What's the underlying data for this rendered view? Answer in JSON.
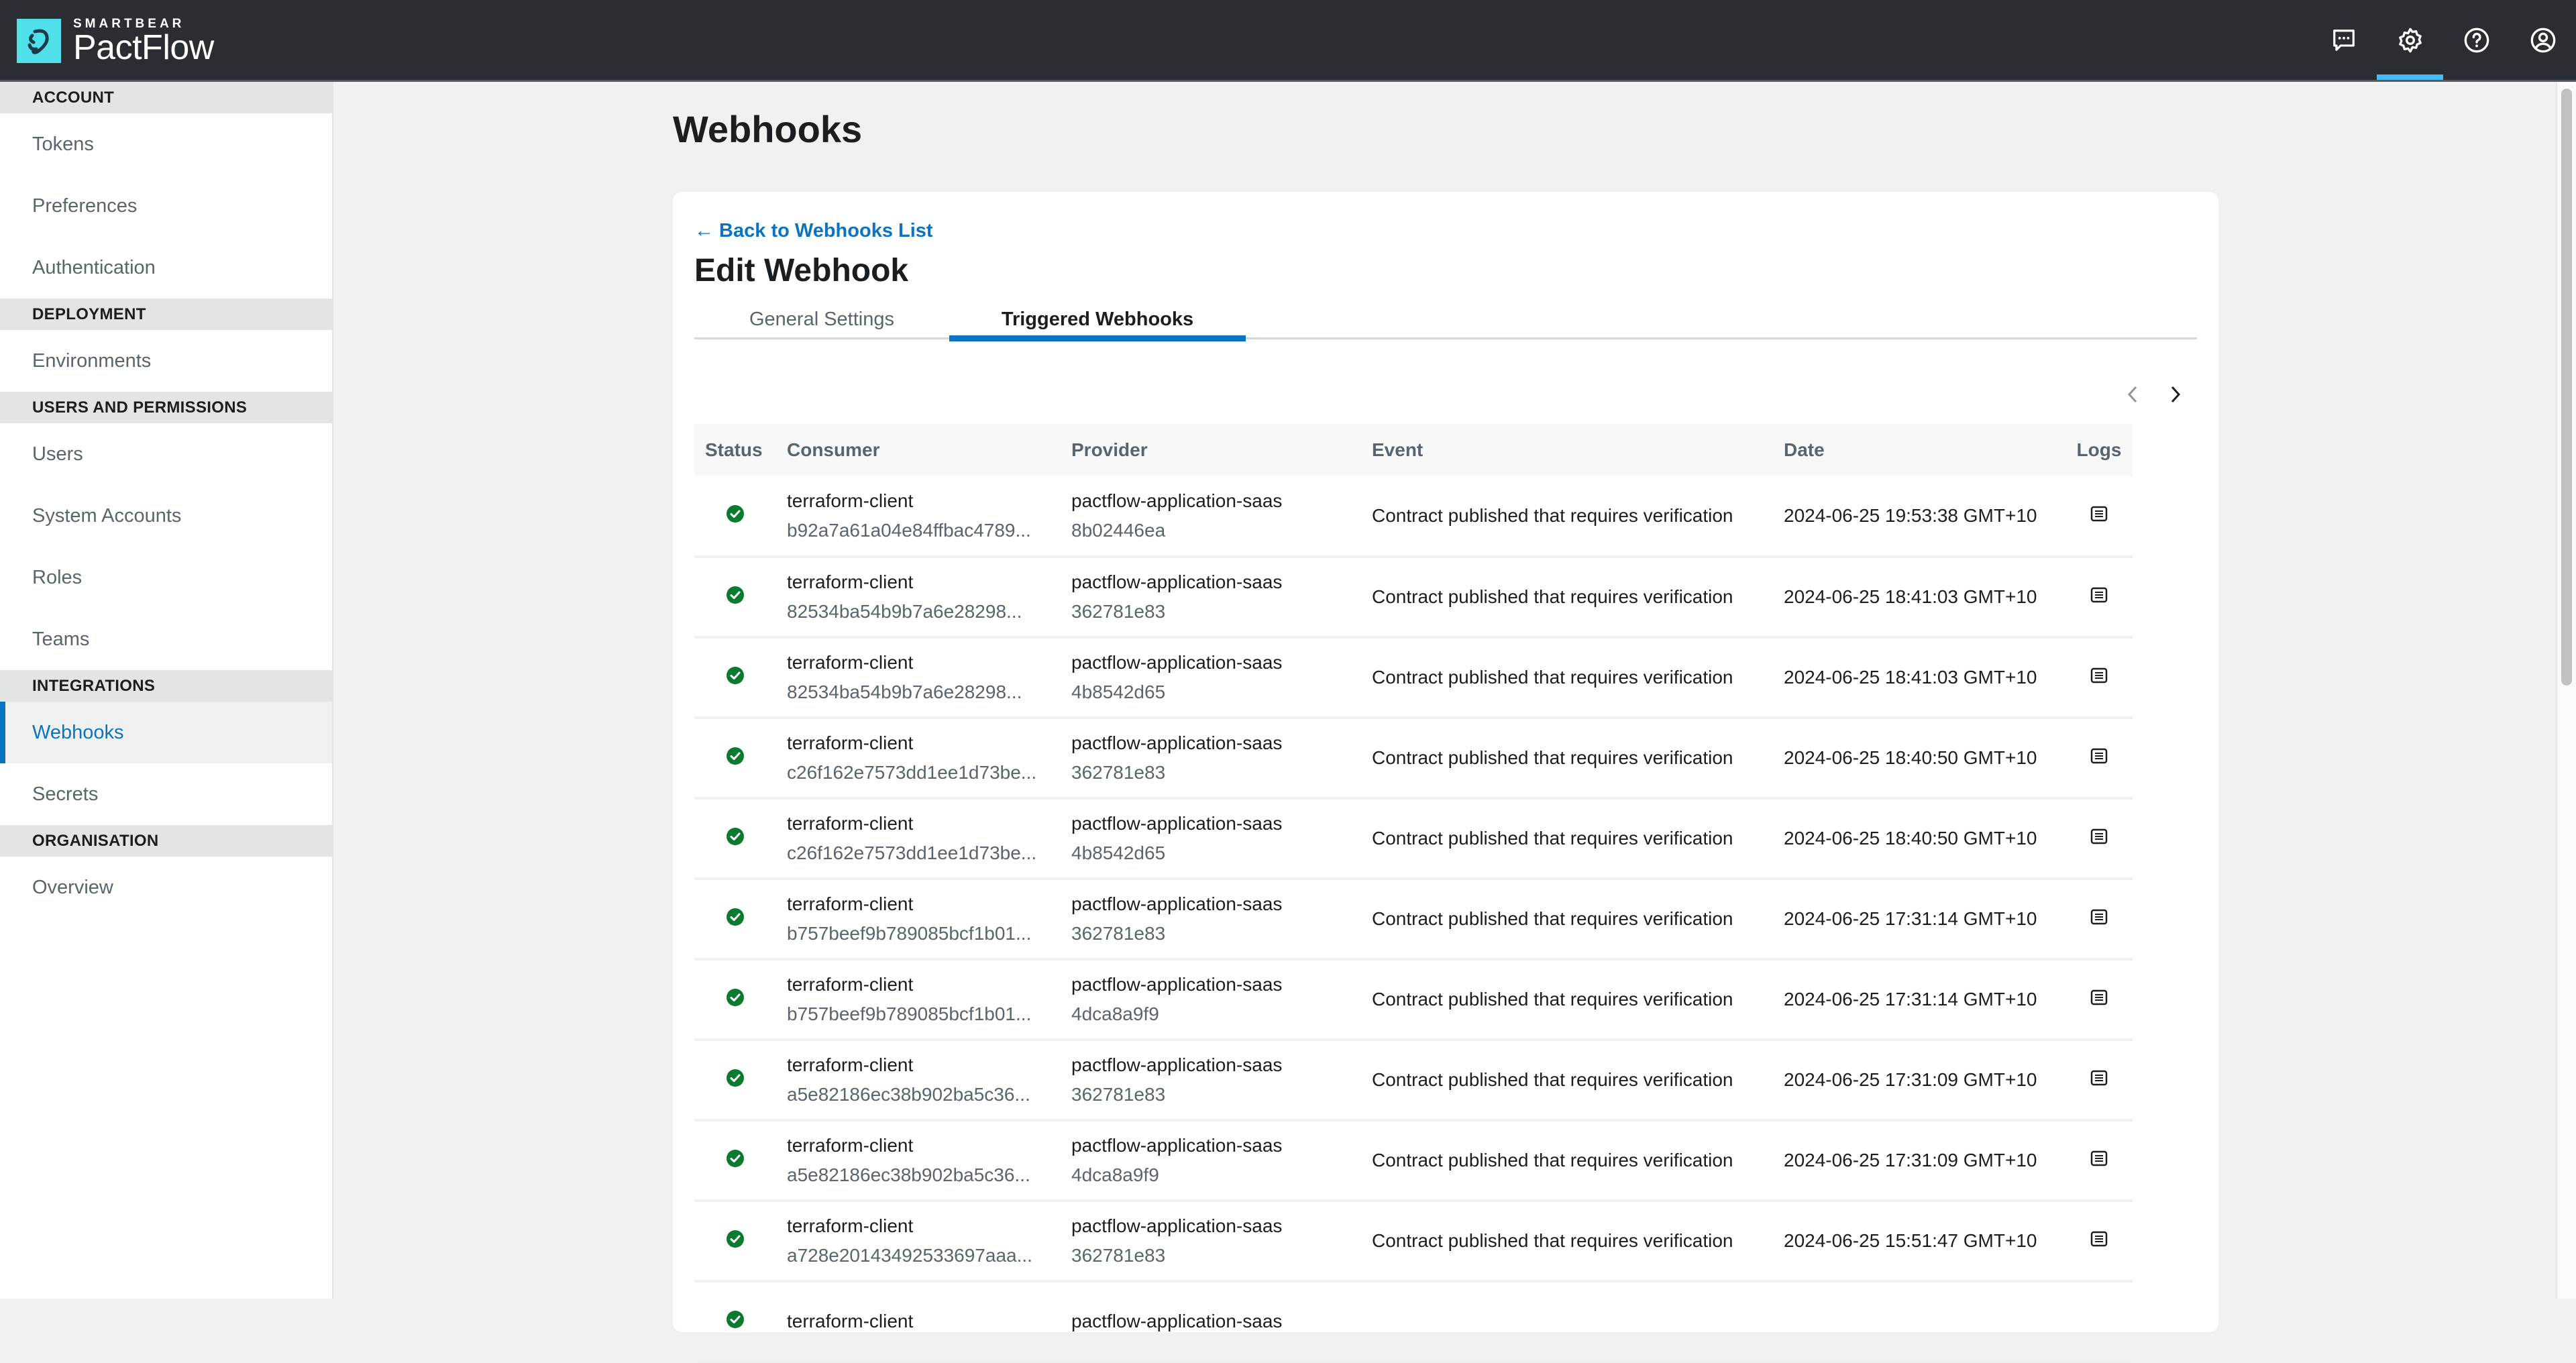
{
  "header": {
    "brand_sub": "SMARTBEAR",
    "brand_name": "PactFlow",
    "icons": [
      {
        "name": "feedback-icon",
        "label": "Feedback"
      },
      {
        "name": "settings-icon",
        "label": "Settings",
        "active": true
      },
      {
        "name": "help-icon",
        "label": "Help"
      },
      {
        "name": "account-icon",
        "label": "Account"
      }
    ],
    "accent": "#42bbf7"
  },
  "sidebar": {
    "sections": [
      {
        "title": "ACCOUNT",
        "items": [
          "Tokens",
          "Preferences",
          "Authentication"
        ]
      },
      {
        "title": "DEPLOYMENT",
        "items": [
          "Environments"
        ]
      },
      {
        "title": "USERS AND PERMISSIONS",
        "items": [
          "Users",
          "System Accounts",
          "Roles",
          "Teams"
        ]
      },
      {
        "title": "INTEGRATIONS",
        "items": [
          "Webhooks",
          "Secrets"
        ]
      },
      {
        "title": "ORGANISATION",
        "items": [
          "Overview"
        ]
      }
    ],
    "active_item": "Webhooks"
  },
  "main": {
    "page_title": "Webhooks",
    "back_link": "← Back to Webhooks List",
    "card_title": "Edit Webhook",
    "tabs": [
      {
        "label": "General Settings",
        "active": false
      },
      {
        "label": "Triggered Webhooks",
        "active": true
      }
    ],
    "pager": {
      "prev_enabled": false,
      "next_enabled": true
    }
  },
  "table": {
    "columns": [
      "Status",
      "Consumer",
      "Provider",
      "Event",
      "Date",
      "Logs"
    ],
    "rows": [
      {
        "status": "success",
        "consumer": "terraform-client",
        "consumer_version": "b92a7a61a04e84ffbac4789...",
        "provider": "pactflow-application-saas",
        "provider_version": "8b02446ea",
        "event": "Contract published that requires verification",
        "date": "2024-06-25 19:53:38 GMT+10"
      },
      {
        "status": "success",
        "consumer": "terraform-client",
        "consumer_version": "82534ba54b9b7a6e28298...",
        "provider": "pactflow-application-saas",
        "provider_version": "362781e83",
        "event": "Contract published that requires verification",
        "date": "2024-06-25 18:41:03 GMT+10"
      },
      {
        "status": "success",
        "consumer": "terraform-client",
        "consumer_version": "82534ba54b9b7a6e28298...",
        "provider": "pactflow-application-saas",
        "provider_version": "4b8542d65",
        "event": "Contract published that requires verification",
        "date": "2024-06-25 18:41:03 GMT+10"
      },
      {
        "status": "success",
        "consumer": "terraform-client",
        "consumer_version": "c26f162e7573dd1ee1d73be...",
        "provider": "pactflow-application-saas",
        "provider_version": "362781e83",
        "event": "Contract published that requires verification",
        "date": "2024-06-25 18:40:50 GMT+10"
      },
      {
        "status": "success",
        "consumer": "terraform-client",
        "consumer_version": "c26f162e7573dd1ee1d73be...",
        "provider": "pactflow-application-saas",
        "provider_version": "4b8542d65",
        "event": "Contract published that requires verification",
        "date": "2024-06-25 18:40:50 GMT+10"
      },
      {
        "status": "success",
        "consumer": "terraform-client",
        "consumer_version": "b757beef9b789085bcf1b01...",
        "provider": "pactflow-application-saas",
        "provider_version": "362781e83",
        "event": "Contract published that requires verification",
        "date": "2024-06-25 17:31:14 GMT+10"
      },
      {
        "status": "success",
        "consumer": "terraform-client",
        "consumer_version": "b757beef9b789085bcf1b01...",
        "provider": "pactflow-application-saas",
        "provider_version": "4dca8a9f9",
        "event": "Contract published that requires verification",
        "date": "2024-06-25 17:31:14 GMT+10"
      },
      {
        "status": "success",
        "consumer": "terraform-client",
        "consumer_version": "a5e82186ec38b902ba5c36...",
        "provider": "pactflow-application-saas",
        "provider_version": "362781e83",
        "event": "Contract published that requires verification",
        "date": "2024-06-25 17:31:09 GMT+10"
      },
      {
        "status": "success",
        "consumer": "terraform-client",
        "consumer_version": "a5e82186ec38b902ba5c36...",
        "provider": "pactflow-application-saas",
        "provider_version": "4dca8a9f9",
        "event": "Contract published that requires verification",
        "date": "2024-06-25 17:31:09 GMT+10"
      },
      {
        "status": "success",
        "consumer": "terraform-client",
        "consumer_version": "a728e20143492533697aaa...",
        "provider": "pactflow-application-saas",
        "provider_version": "362781e83",
        "event": "Contract published that requires verification",
        "date": "2024-06-25 15:51:47 GMT+10"
      },
      {
        "status": "success",
        "consumer": "terraform-client",
        "consumer_version": "",
        "provider": "pactflow-application-saas",
        "provider_version": "",
        "event": "",
        "date": ""
      }
    ],
    "status_color": "#0a7a2f"
  }
}
